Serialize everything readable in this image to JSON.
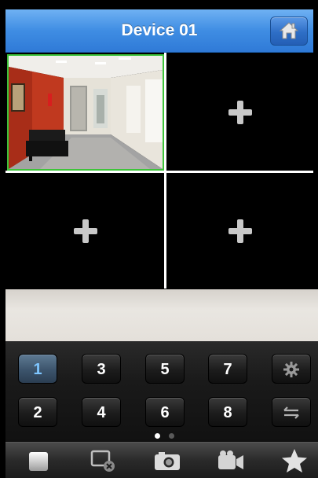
{
  "header": {
    "title": "Device 01"
  },
  "grid": {
    "cells": [
      {
        "state": "live-feed"
      },
      {
        "state": "empty"
      },
      {
        "state": "empty"
      },
      {
        "state": "empty"
      }
    ]
  },
  "channels": {
    "selected": "1",
    "top_row": [
      "1",
      "3",
      "5",
      "7"
    ],
    "bottom_row": [
      "2",
      "4",
      "6",
      "8"
    ]
  },
  "pager": {
    "pages": 2,
    "current": 1
  },
  "toolbar": {
    "icons": [
      "stop-icon",
      "close-view-icon",
      "snapshot-camera-icon",
      "record-video-icon",
      "favorites-star-icon"
    ]
  },
  "colors": {
    "header_blue": "#3f8de3",
    "active_cell_border": "#3ec43a",
    "active_channel_text": "#7ec6ff"
  }
}
